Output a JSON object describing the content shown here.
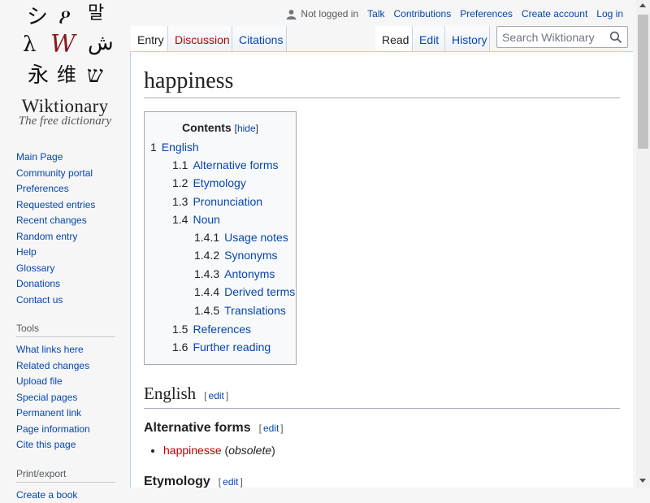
{
  "logo": {
    "glyphs": [
      "シ",
      "ዖ",
      "말",
      "λ",
      "W",
      "ش",
      "永",
      "维",
      "ש"
    ],
    "wordmark": "Wiktionary",
    "tagline": "The free dictionary"
  },
  "sidebar": {
    "navigation": [
      "Main Page",
      "Community portal",
      "Preferences",
      "Requested entries",
      "Recent changes",
      "Random entry",
      "Help",
      "Glossary",
      "Donations",
      "Contact us"
    ],
    "tools_heading": "Tools",
    "tools": [
      "What links here",
      "Related changes",
      "Upload file",
      "Special pages",
      "Permanent link",
      "Page information",
      "Cite this page"
    ],
    "print_heading": "Print/export",
    "print": [
      "Create a book"
    ]
  },
  "personal": {
    "not_logged_in": "Not logged in",
    "talk": "Talk",
    "contributions": "Contributions",
    "preferences": "Preferences",
    "create_account": "Create account",
    "login": "Log in"
  },
  "tabs": {
    "entry": "Entry",
    "discussion": "Discussion",
    "citations": "Citations",
    "read": "Read",
    "edit": "Edit",
    "history": "History"
  },
  "search": {
    "placeholder": "Search Wiktionary"
  },
  "page": {
    "title": "happiness",
    "toc": {
      "title": "Contents",
      "toggle_open": "[",
      "toggle": "hide",
      "toggle_close": "]",
      "items": [
        {
          "num": "1",
          "label": "English"
        },
        {
          "num": "1.1",
          "label": "Alternative forms"
        },
        {
          "num": "1.2",
          "label": "Etymology"
        },
        {
          "num": "1.3",
          "label": "Pronunciation"
        },
        {
          "num": "1.4",
          "label": "Noun"
        },
        {
          "num": "1.4.1",
          "label": "Usage notes"
        },
        {
          "num": "1.4.2",
          "label": "Synonyms"
        },
        {
          "num": "1.4.3",
          "label": "Antonyms"
        },
        {
          "num": "1.4.4",
          "label": "Derived terms"
        },
        {
          "num": "1.4.5",
          "label": "Translations"
        },
        {
          "num": "1.5",
          "label": "References"
        },
        {
          "num": "1.6",
          "label": "Further reading"
        }
      ]
    },
    "sections": {
      "english": "English",
      "alt_forms": "Alternative forms",
      "etymology": "Etymology",
      "edit_open": "[",
      "edit": "edit",
      "edit_close": "]"
    },
    "alt_form": {
      "word": "happinesse",
      "open_paren": "(",
      "note": "obsolete",
      "close_paren": ")"
    }
  },
  "colors": {
    "link": "#0645ad",
    "redlink": "#ba0000",
    "border": "#a7d7f9"
  }
}
